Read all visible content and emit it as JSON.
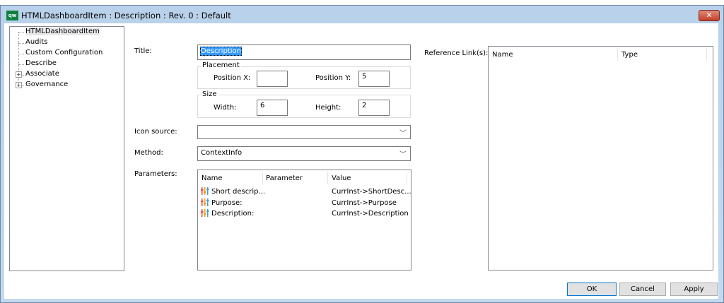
{
  "window": {
    "title": "HTMLDashboardItem : Description : Rev. 0  : Default",
    "logo": "qw",
    "close_label": "✕"
  },
  "tree": {
    "items": [
      {
        "label": "HTMLDashboardItem",
        "selected": true,
        "expandable": false
      },
      {
        "label": "Audits",
        "expandable": false
      },
      {
        "label": "Custom Configuration",
        "expandable": false
      },
      {
        "label": "Describe",
        "expandable": false
      },
      {
        "label": "Associate",
        "expandable": true
      },
      {
        "label": "Governance",
        "expandable": true
      }
    ]
  },
  "form": {
    "title_label": "Title:",
    "title_value": "Description",
    "placement": {
      "label": "Placement",
      "pos_x_label": "Position X:",
      "pos_x_value": "",
      "pos_y_label": "Position Y:",
      "pos_y_value": "5"
    },
    "size": {
      "label": "Size",
      "width_label": "Width:",
      "width_value": "6",
      "height_label": "Height:",
      "height_value": "2"
    },
    "icon_source_label": "Icon source:",
    "icon_source_value": "",
    "method_label": "Method:",
    "method_value": "ContextInfo",
    "parameters_label": "Parameters:",
    "parameters": {
      "columns": [
        "Name",
        "Parameter",
        "Value"
      ],
      "rows": [
        {
          "name": "Short descrip...",
          "parameter": "",
          "value": "CurrInst->ShortDesc..."
        },
        {
          "name": "Purpose:",
          "parameter": "",
          "value": "CurrInst->Purpose"
        },
        {
          "name": "Description:",
          "parameter": "",
          "value": "CurrInst->Description"
        }
      ]
    }
  },
  "reference": {
    "label": "Reference Link(s):",
    "columns": [
      "Name",
      "Type"
    ]
  },
  "buttons": {
    "ok": "OK",
    "cancel": "Cancel",
    "apply": "Apply"
  },
  "colors": {
    "accent": "#0078d7",
    "selection": "#3399ff",
    "close": "#c4402a",
    "logo": "#108040"
  }
}
